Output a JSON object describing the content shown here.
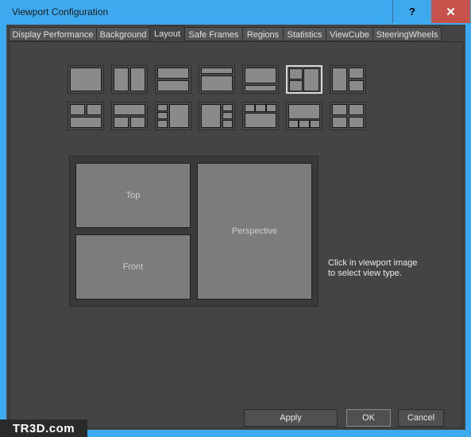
{
  "window": {
    "title": "Viewport Configuration",
    "help_label": "?",
    "close_label": "✕"
  },
  "tabs": [
    {
      "label": "Display Performance"
    },
    {
      "label": "Background"
    },
    {
      "label": "Layout",
      "active": true
    },
    {
      "label": "Safe Frames"
    },
    {
      "label": "Regions"
    },
    {
      "label": "Statistics"
    },
    {
      "label": "ViewCube"
    },
    {
      "label": "SteeringWheels"
    }
  ],
  "layout": {
    "templates_row1_count": 7,
    "templates_row2_count": 7,
    "selected_template": "row1-6",
    "viewports": {
      "top": "Top",
      "front": "Front",
      "perspective": "Perspective"
    },
    "hint": "Click in viewport image to select view type."
  },
  "buttons": {
    "apply": "Apply",
    "ok": "OK",
    "cancel": "Cancel"
  },
  "watermark": "TR3D.com",
  "colors": {
    "title_bar": "#3daaf0",
    "close": "#c7524c",
    "panel": "#444444",
    "viewport": "#7c7c7c"
  }
}
